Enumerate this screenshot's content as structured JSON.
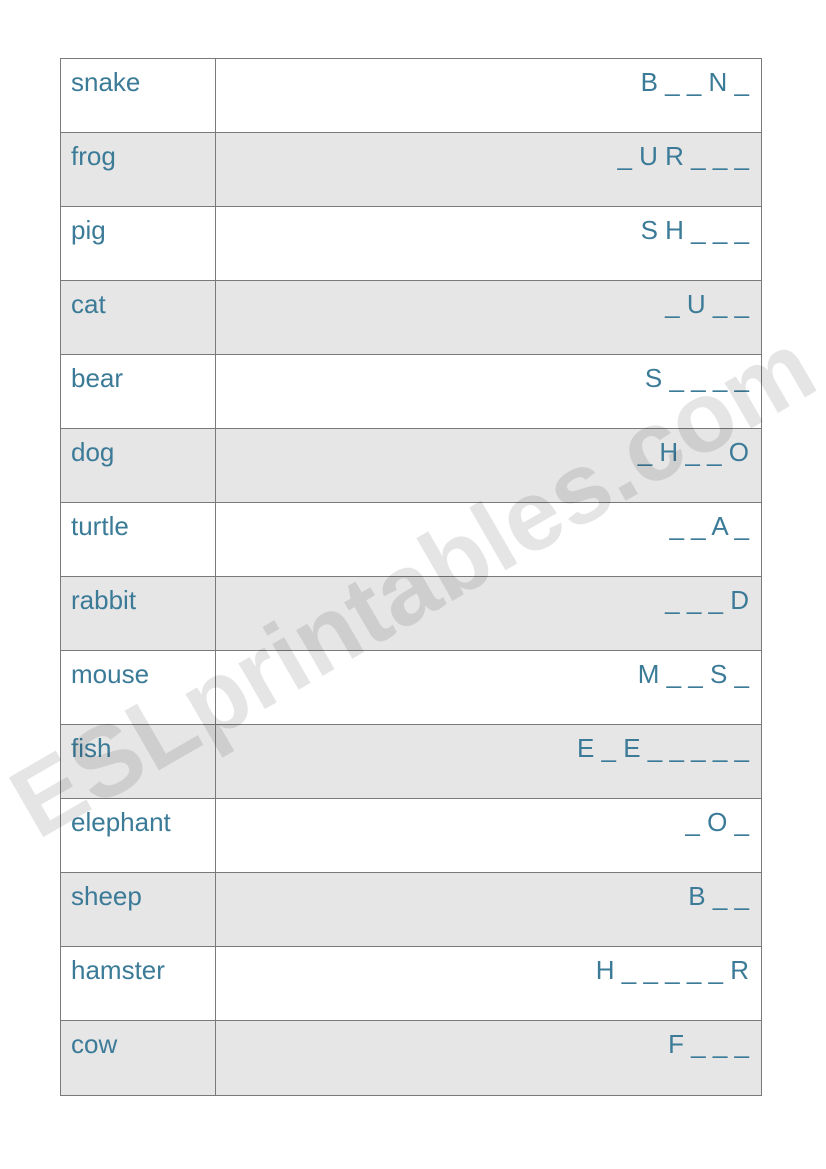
{
  "watermark": "ESLprintables.com",
  "rows": [
    {
      "left": "snake",
      "right": "B _ _ N _"
    },
    {
      "left": "frog",
      "right": "_ U R _ _ _"
    },
    {
      "left": "pig",
      "right": "S H _ _ _"
    },
    {
      "left": "cat",
      "right": "_ U _ _"
    },
    {
      "left": "bear",
      "right": "S _ _ _ _"
    },
    {
      "left": "dog",
      "right": "_ H _ _ O"
    },
    {
      "left": "turtle",
      "right": "_ _ A _"
    },
    {
      "left": "rabbit",
      "right": "_ _ _ D"
    },
    {
      "left": "mouse",
      "right": "M _ _ S _"
    },
    {
      "left": "fish",
      "right": "E _ E _ _ _ _ _"
    },
    {
      "left": "elephant",
      "right": "_ O _"
    },
    {
      "left": "sheep",
      "right": "B _ _"
    },
    {
      "left": "hamster",
      "right": "H _ _ _ _ _ R"
    },
    {
      "left": "cow",
      "right": "F _ _ _"
    }
  ]
}
